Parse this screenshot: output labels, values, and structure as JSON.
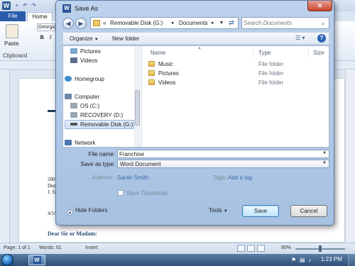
{
  "word": {
    "file_tab": "File",
    "home_tab": "Home",
    "font_name": "Georgia",
    "paste_label": "Paste",
    "clipboard_label": "Clipboard",
    "doc_lines": [
      "200",
      "Dep",
      "J. Sl"
    ],
    "doc_date_partial": "4/5/",
    "salutation": "Dear Sir or Madam:"
  },
  "statusbar": {
    "page": "Page: 1 of 1",
    "words": "Words: 61",
    "insert": "Insert",
    "zoom": "90%"
  },
  "taskbar": {
    "clock": "1:23 PM"
  },
  "dialog": {
    "title": "Save As",
    "close_symbol": "✕",
    "breadcrumb": {
      "prefix": "«",
      "segments": [
        "Removable Disk (G:)",
        "Documents"
      ],
      "separator": "▸"
    },
    "search_placeholder": "Search Documents",
    "toolbar": {
      "organize": "Organize",
      "new_folder": "New folder"
    },
    "nav_items": [
      {
        "label": "Pictures",
        "icon": "pictures-icon"
      },
      {
        "label": "Videos",
        "icon": "videos-icon"
      },
      {
        "label": "Homegroup",
        "icon": "homegroup-icon"
      },
      {
        "label": "Computer",
        "icon": "computer-icon"
      },
      {
        "label": "OS (C:)",
        "icon": "drive-icon"
      },
      {
        "label": "RECOVERY (D:)",
        "icon": "drive-icon"
      },
      {
        "label": "Removable Disk (G:)",
        "icon": "usb-drive-icon",
        "selected": true
      },
      {
        "label": "Network",
        "icon": "network-icon"
      }
    ],
    "columns": {
      "name": "Name",
      "type": "Type",
      "size": "Size"
    },
    "files": [
      {
        "name": "Music",
        "type": "File folder"
      },
      {
        "name": "Pictures",
        "type": "File folder"
      },
      {
        "name": "Videos",
        "type": "File folder"
      }
    ],
    "form": {
      "file_name_label": "File name:",
      "file_name_value": "Franchise",
      "save_as_type_label": "Save as type:",
      "save_as_type_value": "Word Document",
      "authors_label": "Authors:",
      "authors_value": "Sarah Smith",
      "tags_label": "Tags:",
      "tags_value": "Add a tag",
      "thumbnail_label": "Save Thumbnail"
    },
    "buttons": {
      "hide_folders": "Hide Folders",
      "tools": "Tools",
      "save": "Save",
      "cancel": "Cancel"
    }
  }
}
